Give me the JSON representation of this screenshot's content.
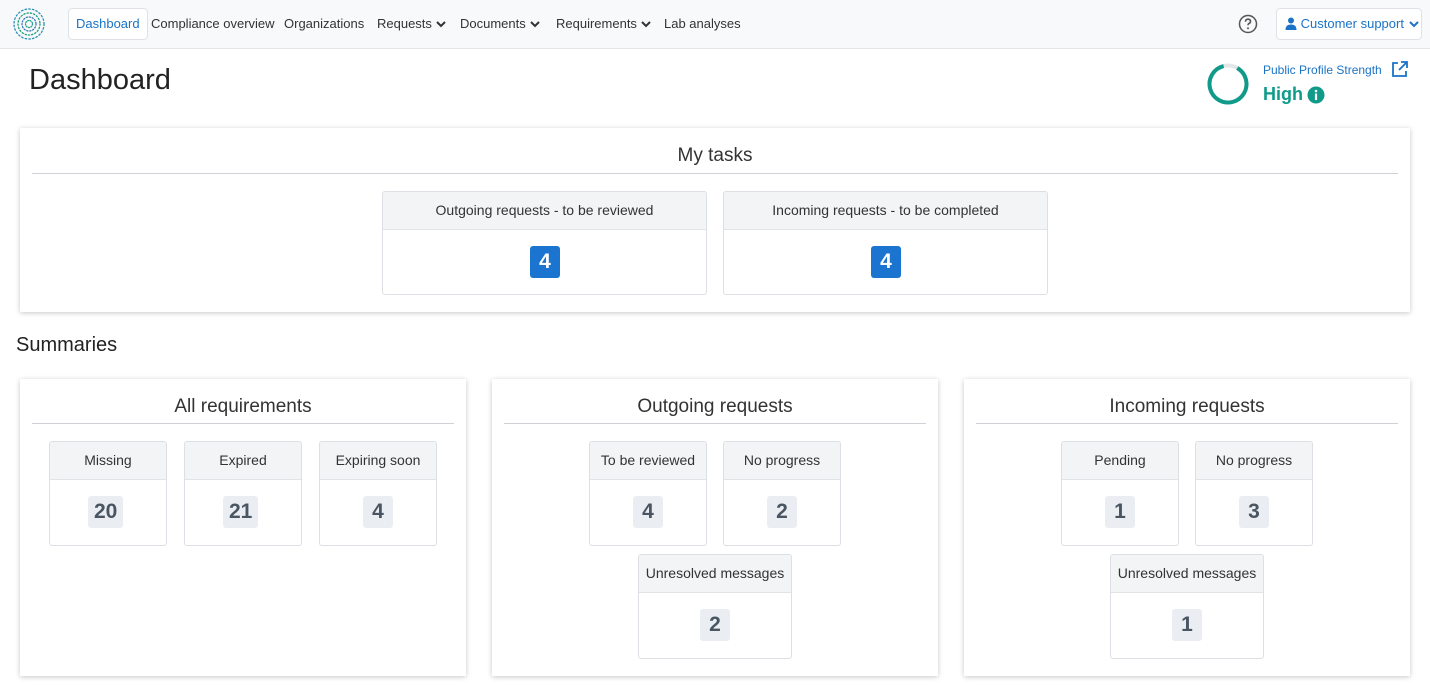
{
  "nav": {
    "items": [
      {
        "label": "Dashboard"
      },
      {
        "label": "Compliance overview"
      },
      {
        "label": "Organizations"
      },
      {
        "label": "Requests"
      },
      {
        "label": "Documents"
      },
      {
        "label": "Requirements"
      },
      {
        "label": "Lab analyses"
      }
    ],
    "user_label": "Customer support"
  },
  "header": {
    "title": "Dashboard",
    "profile_strength_label": "Public Profile Strength",
    "profile_strength_value": "High"
  },
  "my_tasks": {
    "title": "My tasks",
    "tiles": [
      {
        "label": "Outgoing requests - to be reviewed",
        "value": "4"
      },
      {
        "label": "Incoming requests - to be completed",
        "value": "4"
      }
    ]
  },
  "summaries": {
    "heading": "Summaries",
    "all_requirements": {
      "title": "All requirements",
      "tiles": [
        {
          "label": "Missing",
          "value": "20"
        },
        {
          "label": "Expired",
          "value": "21"
        },
        {
          "label": "Expiring soon",
          "value": "4"
        }
      ]
    },
    "outgoing_requests": {
      "title": "Outgoing requests",
      "tiles": [
        {
          "label": "To be reviewed",
          "value": "4"
        },
        {
          "label": "No progress",
          "value": "2"
        },
        {
          "label": "Unresolved messages",
          "value": "2"
        }
      ]
    },
    "incoming_requests": {
      "title": "Incoming requests",
      "tiles": [
        {
          "label": "Pending",
          "value": "1"
        },
        {
          "label": "No progress",
          "value": "3"
        },
        {
          "label": "Unresolved messages",
          "value": "1"
        }
      ]
    }
  },
  "colors": {
    "accent": "#1a73c6",
    "badge_blue": "#1b75d0",
    "strength": "#0f9a8a"
  }
}
